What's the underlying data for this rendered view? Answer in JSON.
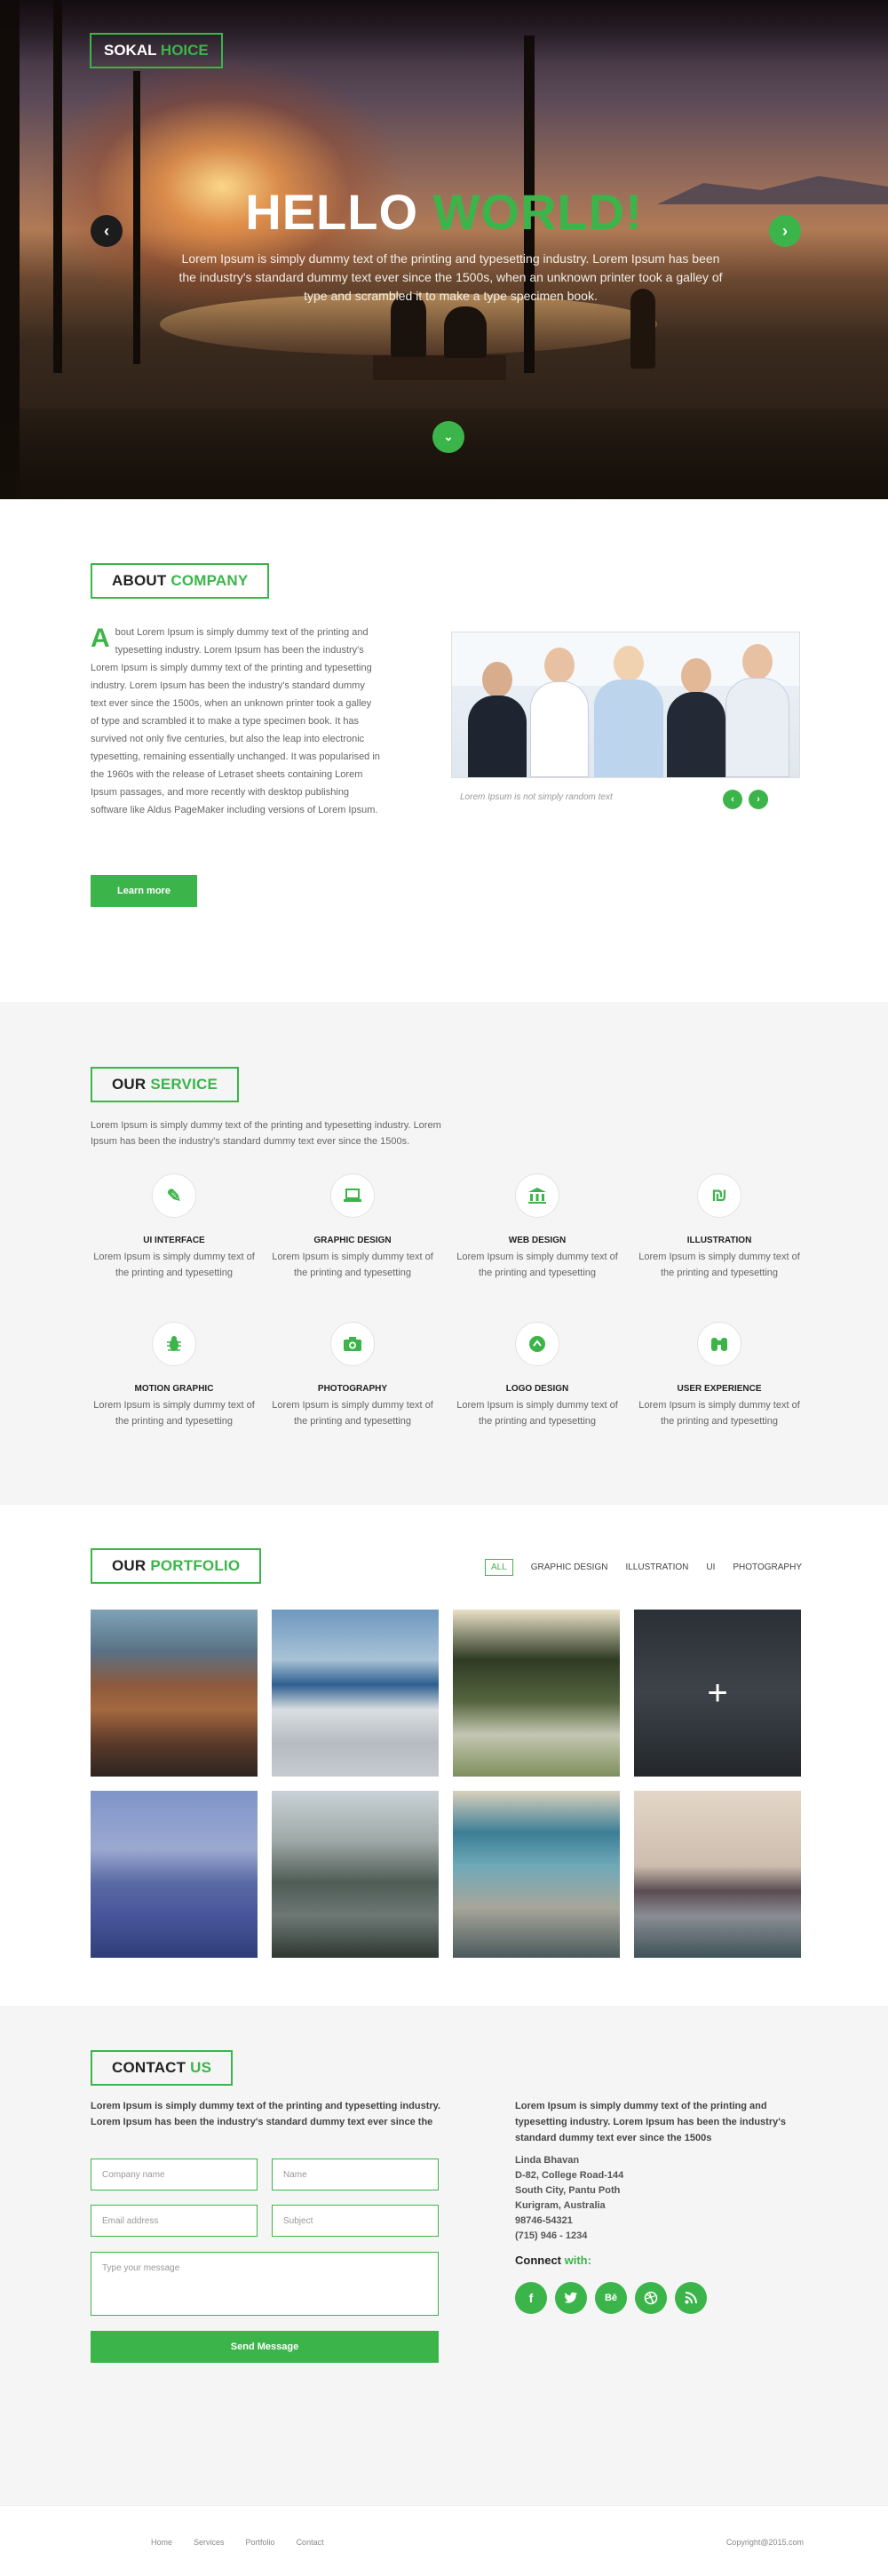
{
  "brand": {
    "name_part1": "SOKAL ",
    "name_part2": "HOICE"
  },
  "hero": {
    "title_part1": "HELLO ",
    "title_part2": "WORLD!",
    "text": "Lorem Ipsum is simply dummy text of the printing and typesetting industry. Lorem Ipsum has been the industry's standard dummy text ever since the 1500s, when an unknown printer took a galley of type and scrambled it to make a type specimen book."
  },
  "about": {
    "title_part1": "ABOUT ",
    "title_part2": "COMPANY",
    "dropcap": "A",
    "text": "bout Lorem Ipsum is simply dummy text of the printing and typesetting industry. Lorem Ipsum has been the industry's Lorem Ipsum is simply dummy text of the printing and typesetting industry. Lorem Ipsum has been the industry's standard dummy text ever since the 1500s, when an unknown printer took a galley of type and scrambled it to make a type specimen book. It has survived not only five centuries, but also the leap into electronic typesetting, remaining essentially unchanged. It was popularised in the 1960s with the release of Letraset sheets containing Lorem Ipsum passages, and more recently with desktop publishing software like Aldus PageMaker including versions of Lorem Ipsum.",
    "button": "Learn more",
    "caption": "Lorem Ipsum is not simply random text"
  },
  "service": {
    "title_part1": "OUR ",
    "title_part2": "SERVICE",
    "intro": "Lorem Ipsum is simply dummy text of the printing and typesetting industry. Lorem Ipsum has been the industry's standard dummy text ever since the 1500s.",
    "items": [
      {
        "title": "UI INTERFACE",
        "text": "Lorem Ipsum is simply dummy text of the printing and typesetting",
        "icon": "pen-icon"
      },
      {
        "title": "GRAPHIC DESIGN",
        "text": "Lorem Ipsum is simply dummy text of the printing and typesetting",
        "icon": "laptop-icon"
      },
      {
        "title": "WEB DESIGN",
        "text": "Lorem Ipsum is simply dummy text of the printing and typesetting",
        "icon": "bank-icon"
      },
      {
        "title": "ILLUSTRATION",
        "text": "Lorem Ipsum is simply dummy text of the printing and typesetting",
        "icon": "shekel-icon"
      },
      {
        "title": "MOTION GRAPHIC",
        "text": "Lorem Ipsum is simply dummy text of the printing and typesetting",
        "icon": "bug-icon"
      },
      {
        "title": "PHOTOGRAPHY",
        "text": "Lorem Ipsum is simply dummy text of the printing and typesetting",
        "icon": "camera-icon"
      },
      {
        "title": "LOGO DESIGN",
        "text": "Lorem Ipsum is simply dummy text of the printing and typesetting",
        "icon": "chevron-up-circle-icon"
      },
      {
        "title": "USER EXPERIENCE",
        "text": "Lorem Ipsum is simply dummy text of the printing and typesetting",
        "icon": "binoculars-icon"
      }
    ]
  },
  "portfolio": {
    "title_part1": "OUR ",
    "title_part2": "PORTFOLIO",
    "filters": [
      "ALL",
      "GRAPHIC DESIGN",
      "ILLUSTRATION",
      "UI",
      "PHOTOGRAPHY"
    ]
  },
  "contact": {
    "title_part1": "CONTACT ",
    "title_part2": "US",
    "intro": "Lorem Ipsum is simply dummy text of the printing and typesetting industry. Lorem Ipsum has been the industry's standard dummy text ever since the",
    "placeholders": {
      "company": "Company name",
      "name": "Name",
      "email": "Email address",
      "subject": "Subject",
      "message": "Type your message"
    },
    "button": "Send Message",
    "right_text": "Lorem Ipsum is simply dummy text of the printing and typesetting industry. Lorem Ipsum has been the industry's standard dummy text ever since the 1500s",
    "address": [
      "Linda Bhavan",
      "D-82, College Road-144",
      "South City, Pantu Poth",
      "Kurigram,  Australia",
      "98746-54321",
      "(715) 946 - 1234"
    ],
    "connect_part1": "Connect ",
    "connect_part2": "with:",
    "socials": [
      "facebook-icon",
      "twitter-icon",
      "behance-icon",
      "dribbble-icon",
      "rss-icon"
    ]
  },
  "footer": {
    "links": [
      "Home",
      "Services",
      "Portfolio",
      "Contact"
    ],
    "copyright": "Copyright@2015.com"
  },
  "colors": {
    "accent": "#3bb54a",
    "dark": "#222222",
    "light_bg": "#f5f5f5"
  }
}
